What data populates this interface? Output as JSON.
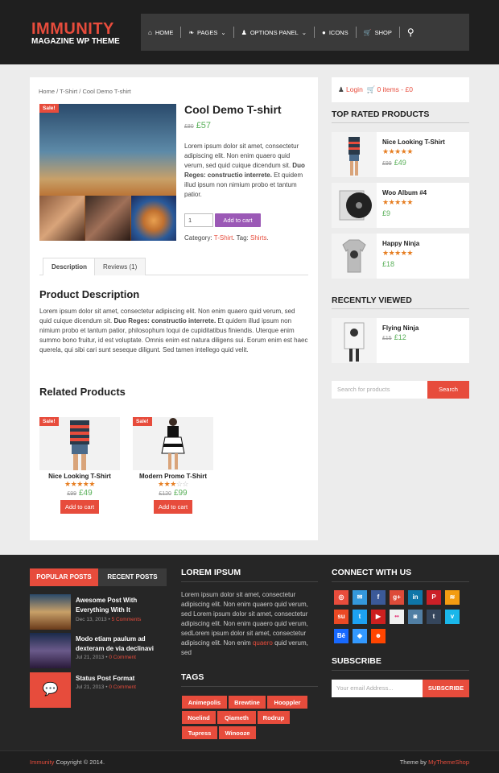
{
  "header": {
    "logo_title": "IMMUNITY",
    "logo_subtitle": "MAGAZINE WP THEME",
    "nav": [
      {
        "label": "HOME",
        "icon": "home-icon"
      },
      {
        "label": "PAGES",
        "icon": "leaf-icon"
      },
      {
        "label": "OPTIONS PANEL",
        "icon": "user-icon"
      },
      {
        "label": "ICONS",
        "icon": "apple-icon"
      },
      {
        "label": "SHOP",
        "icon": "cart-icon"
      }
    ]
  },
  "breadcrumb": "Home / T-Shirt / Cool Demo T-shirt",
  "product": {
    "sale_badge": "Sale!",
    "title": "Cool Demo T-shirt",
    "old_price": "£80",
    "price": "£57",
    "description_pre": "Lorem ipsum dolor sit amet, consectetur adipiscing elit. Non enim quaero quid verum, sed quid cuique dicendum sit. ",
    "description_bold": "Duo Reges: constructio interrete.",
    "description_post": " Et quidem illud ipsum non nimium probo et tantum patior.",
    "qty": "1",
    "add_to_cart": "Add to cart",
    "category_label": "Category:",
    "category": "T-Shirt",
    "tag_label": "Tag:",
    "tag": "Shirts"
  },
  "tabs": [
    "Description",
    "Reviews (1)"
  ],
  "product_description": {
    "heading": "Product Description",
    "pre": "Lorem ipsum dolor sit amet, consectetur adipiscing elit. Non enim quaero quid verum, sed quid cuique dicendum sit. ",
    "bold": "Duo Reges: constructio interrete.",
    "post": " Et quidem illud ipsum non nimium probo et tantum patior, philosophum loqui de cupiditatibus finiendis. Uterque enim summo bono fruitur, id est voluptate. Omnis enim est natura diligens sui. Eorum enim est haec querela, qui sibi cari sunt seseque diligunt. Sed tamen intellego quid velit."
  },
  "related": {
    "heading": "Related Products",
    "items": [
      {
        "sale": "Sale!",
        "name": "Nice Looking T-Shirt",
        "rating": 5,
        "old_price": "£99",
        "price": "£49",
        "button": "Add to cart"
      },
      {
        "sale": "Sale!",
        "name": "Modern Promo T-Shirt",
        "rating": 3,
        "old_price": "£120",
        "price": "£99",
        "button": "Add to cart"
      }
    ]
  },
  "sidebar": {
    "login": "Login",
    "cart": "0 items - £0",
    "top_rated_heading": "TOP RATED PRODUCTS",
    "top_rated": [
      {
        "name": "Nice Looking T-Shirt",
        "rating": 5,
        "old_price": "£99",
        "price": "£49"
      },
      {
        "name": "Woo Album #4",
        "rating": 5,
        "old_price": "",
        "price": "£9"
      },
      {
        "name": "Happy Ninja",
        "rating": 5,
        "old_price": "",
        "price": "£18"
      }
    ],
    "recently_viewed_heading": "RECENTLY VIEWED",
    "recently_viewed": {
      "name": "Flying Ninja",
      "old_price": "£15",
      "price": "£12"
    },
    "search_placeholder": "Search for products",
    "search_button": "Search"
  },
  "footer": {
    "tabs": [
      "POPULAR POSTS",
      "RECENT POSTS"
    ],
    "posts": [
      {
        "title": "Awesome Post With Everything With It",
        "date": "Dec 13, 2013",
        "comments": "5 Comments"
      },
      {
        "title": "Modo etiam paulum ad dexteram de via declinavi",
        "date": "Jul 21, 2013",
        "comments": "0 Comment"
      },
      {
        "title": "Status Post Format",
        "date": "Jul 21, 2013",
        "comments": "0 Comment"
      }
    ],
    "lorem_heading": "LOREM IPSUM",
    "lorem_pre": "Lorem ipsum dolor sit amet, consectetur adipiscing elit. Non enim quaero quid verum, sed Lorem ipsum dolor sit amet, consectetur adipiscing elit. Non enim quaero quid verum, sedLorem ipsum dolor sit amet, consectetur adipiscing elit. Non enim ",
    "lorem_link": "quaero",
    "lorem_post": " quid verum, sed",
    "tags_heading": "TAGS",
    "tags": [
      "Animepolis",
      "Brewtine",
      "Hooppler",
      "Noelind",
      "Qiameth",
      "Rodrup",
      "Tupress",
      "Winooze"
    ],
    "connect_heading": "CONNECT WITH US",
    "social": [
      {
        "icon": "dribbble-icon",
        "glyph": "◎",
        "color": "#e74c3c"
      },
      {
        "icon": "email-icon",
        "glyph": "✉",
        "color": "#3498db"
      },
      {
        "icon": "facebook-icon",
        "glyph": "f",
        "color": "#3b5998"
      },
      {
        "icon": "google-plus-icon",
        "glyph": "g+",
        "color": "#dd4b39"
      },
      {
        "icon": "linkedin-icon",
        "glyph": "in",
        "color": "#0e76a8"
      },
      {
        "icon": "pinterest-icon",
        "glyph": "P",
        "color": "#cb2027"
      },
      {
        "icon": "rss-icon",
        "glyph": "≋",
        "color": "#f39c12"
      },
      {
        "icon": "stumbleupon-icon",
        "glyph": "su",
        "color": "#eb4924"
      },
      {
        "icon": "twitter-icon",
        "glyph": "t",
        "color": "#1da1f2"
      },
      {
        "icon": "youtube-icon",
        "glyph": "▶",
        "color": "#cd201f"
      },
      {
        "icon": "flickr-icon",
        "glyph": "••",
        "color": "#f0f0f0"
      },
      {
        "icon": "instagram-icon",
        "glyph": "◙",
        "color": "#517fa4"
      },
      {
        "icon": "tumblr-icon",
        "glyph": "t",
        "color": "#35465c"
      },
      {
        "icon": "vimeo-icon",
        "glyph": "v",
        "color": "#1ab7ea"
      },
      {
        "icon": "behance-icon",
        "glyph": "Bē",
        "color": "#1769ff"
      },
      {
        "icon": "delicious-icon",
        "glyph": "◆",
        "color": "#3399ff"
      },
      {
        "icon": "reddit-icon",
        "glyph": "☻",
        "color": "#ff4500"
      }
    ],
    "subscribe_heading": "SUBSCRIBE",
    "email_placeholder": "Your email Address...",
    "subscribe_button": "SUBSCRIBE"
  },
  "bottom": {
    "site": "Immunity",
    "copyright": " Copyright © 2014.",
    "theme_by": "Theme by ",
    "author": "MyThemeShop"
  }
}
